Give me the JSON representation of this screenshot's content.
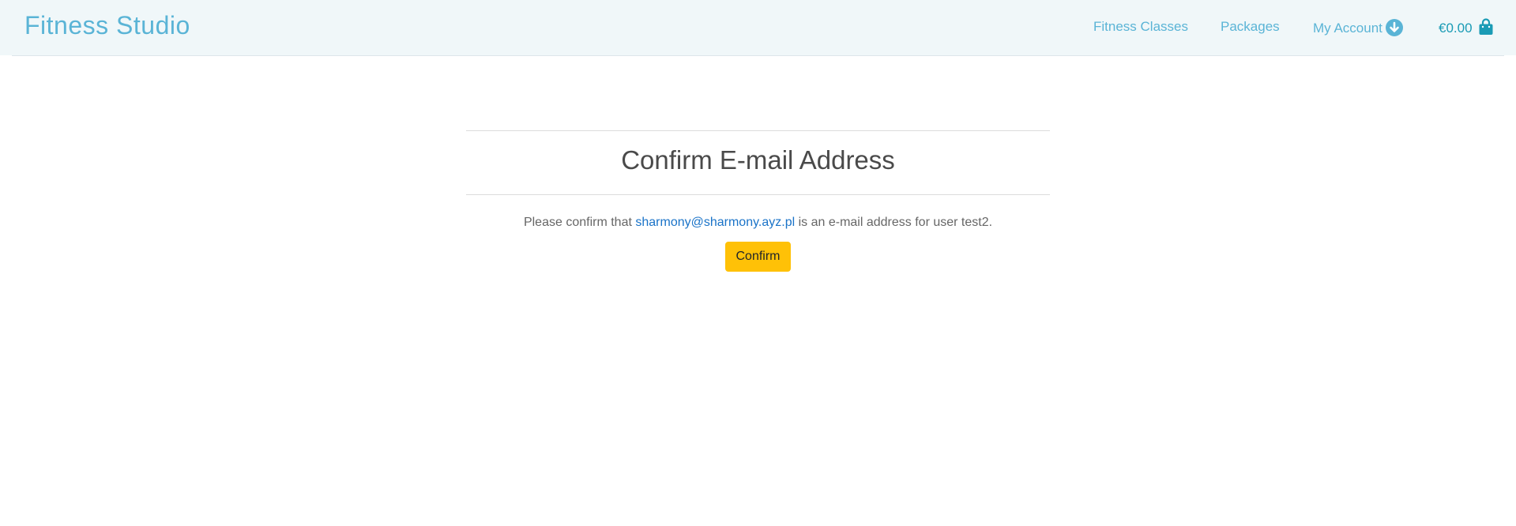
{
  "header": {
    "brand": "Fitness Studio",
    "nav": {
      "fitness_classes": "Fitness Classes",
      "packages": "Packages",
      "my_account": "My Account"
    },
    "cart": {
      "amount": "€0.00",
      "icon": "shopping-bag-icon"
    },
    "account_icon": "arrow-down-circle-icon",
    "colors": {
      "navbar_bg": "#f0f7f9",
      "brand": "#5ab4d6",
      "cart": "#1a9bb5"
    }
  },
  "main": {
    "title": "Confirm E-mail Address",
    "message_prefix": "Please confirm that ",
    "email": "sharmony@sharmony.ayz.pl",
    "message_suffix": " is an e-mail address for user test2.",
    "confirm_label": "Confirm",
    "colors": {
      "button": "#ffc107",
      "link": "#1a73c8"
    }
  }
}
